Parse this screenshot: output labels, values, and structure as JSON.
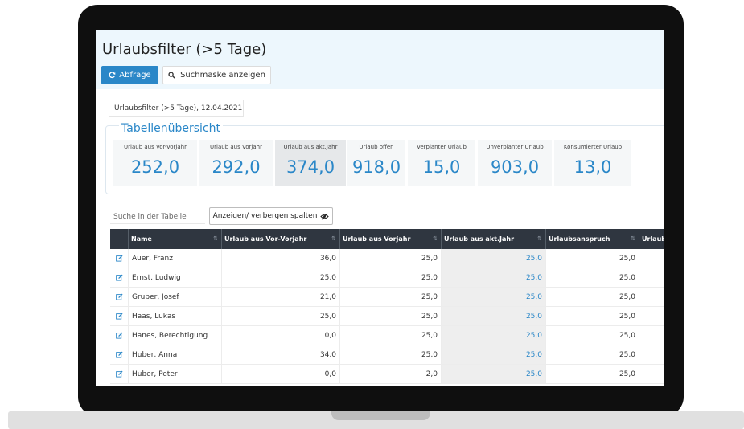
{
  "page": {
    "title": "Urlaubsfilter (>5 Tage)",
    "query_button": "Abfrage",
    "search_mask_button": "Suchmaske anzeigen",
    "filter_label": "Urlaubsfilter (>5 Tage), 12.04.2021"
  },
  "overview": {
    "title": "Tabellenübersicht",
    "stats": [
      {
        "label": "Urlaub aus Vor-Vorjahr",
        "value": "252,0"
      },
      {
        "label": "Urlaub aus Vorjahr",
        "value": "292,0"
      },
      {
        "label": "Urlaub aus akt.Jahr",
        "value": "374,0"
      },
      {
        "label": "Urlaub offen",
        "value": "918,0"
      },
      {
        "label": "Verplanter Urlaub",
        "value": "15,0"
      },
      {
        "label": "Unverplanter Urlaub",
        "value": "903,0"
      },
      {
        "label": "Konsumierter Urlaub",
        "value": "13,0"
      }
    ]
  },
  "table_controls": {
    "search_placeholder": "Suche in der Tabelle",
    "columns_button": "Anzeigen/ verbergen spalten"
  },
  "table": {
    "columns": [
      "Name",
      "Urlaub aus Vor-Vorjahr",
      "Urlaub aus Vorjahr",
      "Urlaub aus akt.Jahr",
      "Urlaubsanspruch",
      "Urlaub"
    ],
    "rows": [
      {
        "name": "Auer, Franz",
        "vorvorjahr": "36,0",
        "vorjahr": "25,0",
        "aktjahr": "25,0",
        "anspruch": "25,0"
      },
      {
        "name": "Ernst, Ludwig",
        "vorvorjahr": "25,0",
        "vorjahr": "25,0",
        "aktjahr": "25,0",
        "anspruch": "25,0"
      },
      {
        "name": "Gruber, Josef",
        "vorvorjahr": "21,0",
        "vorjahr": "25,0",
        "aktjahr": "25,0",
        "anspruch": "25,0"
      },
      {
        "name": "Haas, Lukas",
        "vorvorjahr": "25,0",
        "vorjahr": "25,0",
        "aktjahr": "25,0",
        "anspruch": "25,0"
      },
      {
        "name": "Hanes, Berechtigung",
        "vorvorjahr": "0,0",
        "vorjahr": "25,0",
        "aktjahr": "25,0",
        "anspruch": "25,0"
      },
      {
        "name": "Huber, Anna",
        "vorvorjahr": "34,0",
        "vorjahr": "25,0",
        "aktjahr": "25,0",
        "anspruch": "25,0"
      },
      {
        "name": "Huber, Peter",
        "vorvorjahr": "0,0",
        "vorjahr": "2,0",
        "aktjahr": "25,0",
        "anspruch": "25,0"
      }
    ]
  },
  "colors": {
    "accent": "#2a87c8",
    "header_bg": "#2f3640",
    "topbar_bg": "#edf7fd",
    "highlight_col": "#eeeeee"
  },
  "icons": {
    "query": "refresh-icon",
    "search": "search-icon",
    "columns": "eye-slash-icon",
    "row_action": "edit-icon",
    "sort": "sort-icon"
  }
}
